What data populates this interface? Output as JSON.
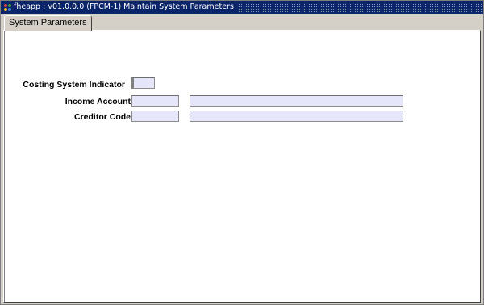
{
  "window": {
    "title": "fheapp : v01.0.0.0 (FPCM-1) Maintain System Parameters",
    "icon": "app-icon"
  },
  "tabs": [
    {
      "label": "System Parameters",
      "active": true
    }
  ],
  "form": {
    "costing_system_indicator": {
      "label": "Costing System Indicator",
      "value": ""
    },
    "income_account": {
      "label": "Income Account",
      "value": "",
      "description": ""
    },
    "creditor_code": {
      "label": "Creditor Code",
      "value": "",
      "description": ""
    }
  },
  "colors": {
    "title_bar": "#0a246a",
    "field_bg": "#e6e6fa",
    "chrome": "#d4d0c8"
  }
}
